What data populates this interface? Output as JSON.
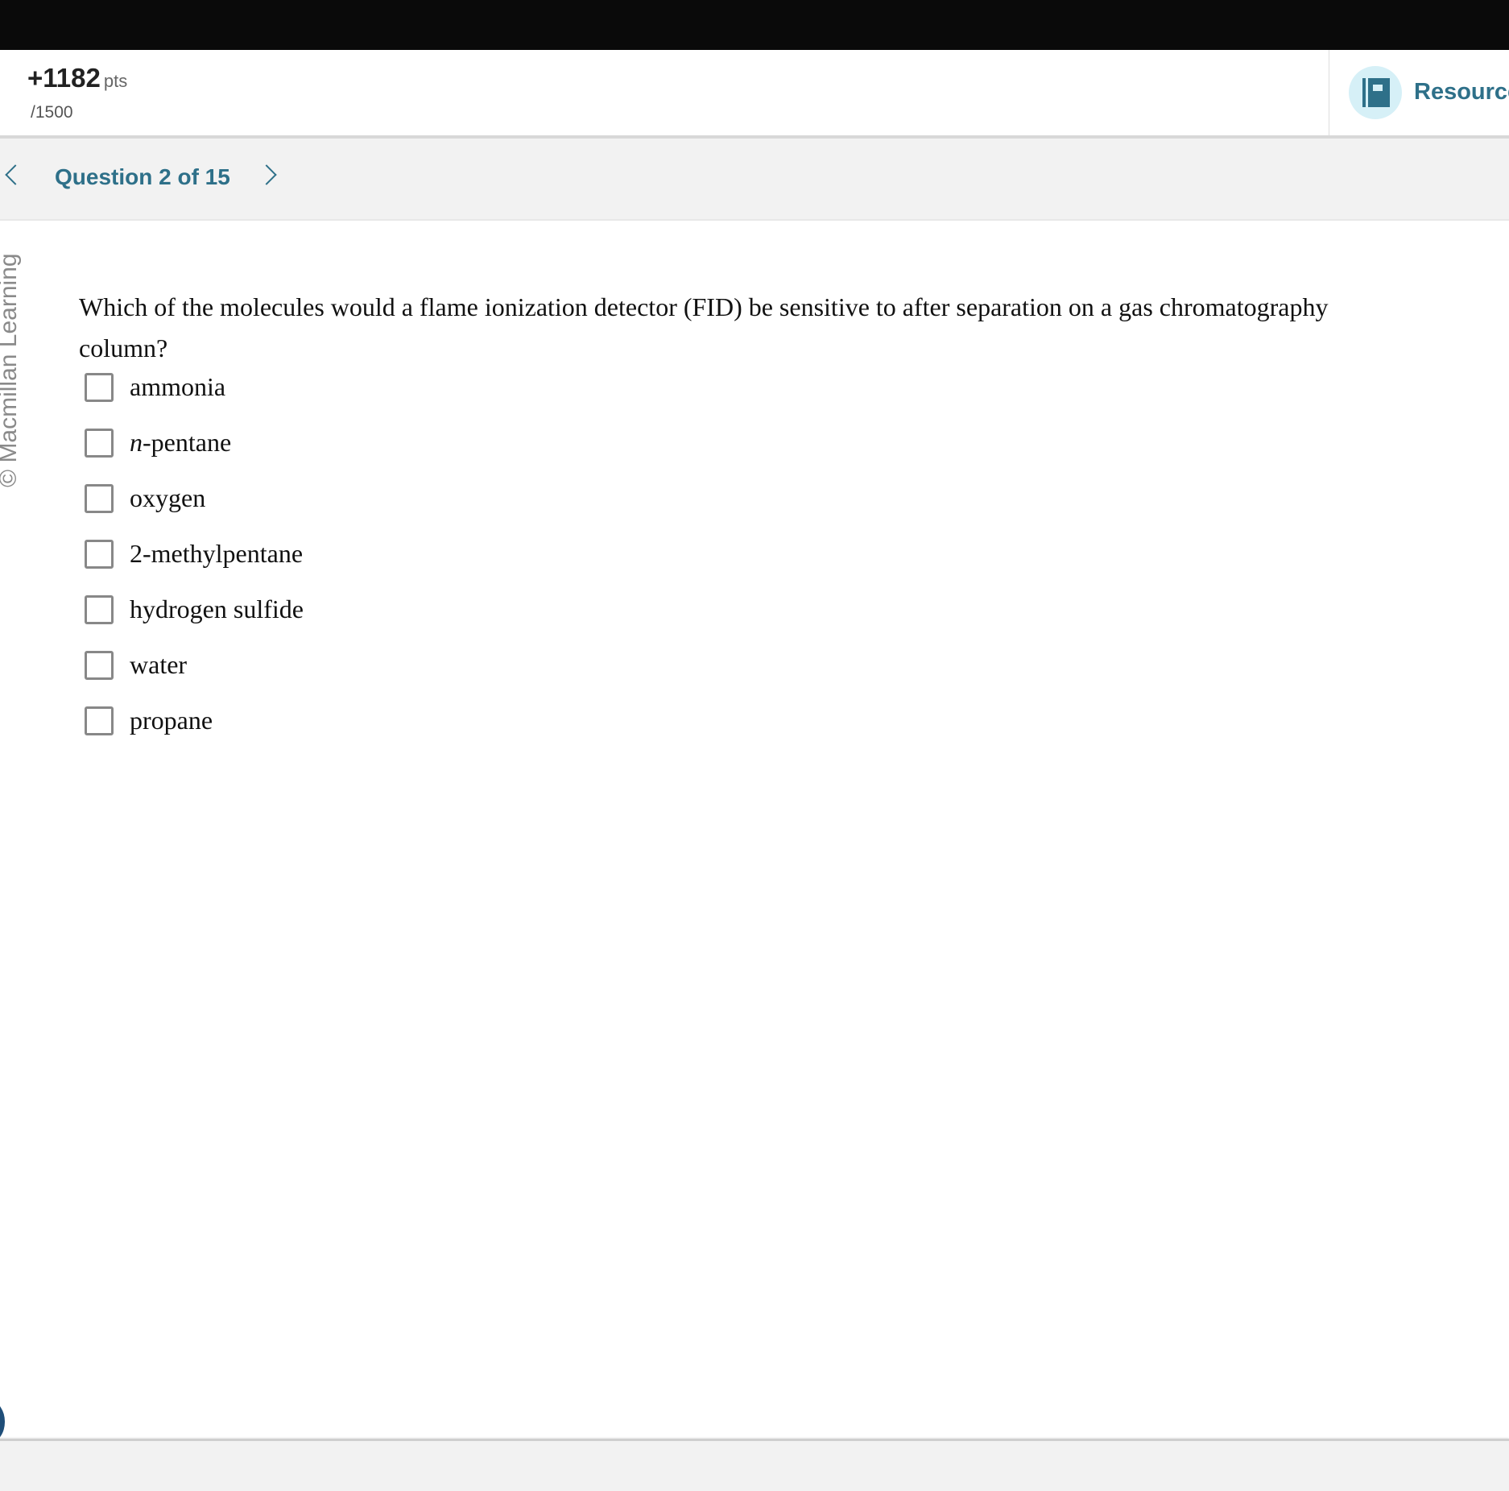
{
  "header": {
    "points_value": "+1182",
    "points_unit": "pts",
    "points_total": "/1500",
    "resources_label": "Resources"
  },
  "nav": {
    "question_label": "Question 2 of 15"
  },
  "watermark": "© Macmillan Learning",
  "question": {
    "text": "Which of the molecules would a flame ionization detector (FID) be sensitive to after separation on a gas chromatography column?",
    "choices": [
      {
        "label": "ammonia",
        "checked": false
      },
      {
        "italic_prefix": "n",
        "label": "-pentane",
        "checked": false
      },
      {
        "label": "oxygen",
        "checked": false
      },
      {
        "label": "2-methylpentane",
        "checked": false
      },
      {
        "label": "hydrogen sulfide",
        "checked": false
      },
      {
        "label": "water",
        "checked": false
      },
      {
        "label": "propane",
        "checked": false
      }
    ]
  },
  "colors": {
    "accent": "#2e7089",
    "accent_bg": "#d6f0f7"
  }
}
